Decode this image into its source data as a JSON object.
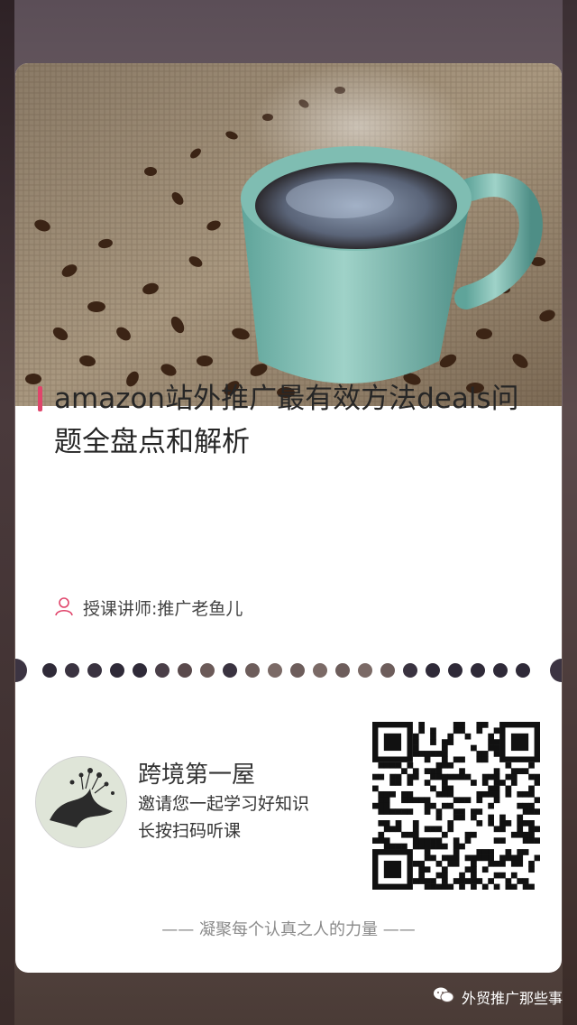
{
  "course": {
    "title": "amazon站外推广最有效方法deals问题全盘点和解析",
    "lecturer": "授课讲师:推广老鱼儿"
  },
  "brand": {
    "name": "跨境第一屋",
    "invite": "邀请您一起学习好知识",
    "action": "长按扫码听课"
  },
  "slogan": "—— 凝聚每个认真之人的力量 ——",
  "footer": {
    "account": "外贸推广那些事",
    "icon": "wechat-icon"
  },
  "colors": {
    "accent": "#e0456b",
    "card": "#ffffff",
    "slogan": "#8a8a8a"
  },
  "icons": {
    "lecturer": "person-icon"
  }
}
